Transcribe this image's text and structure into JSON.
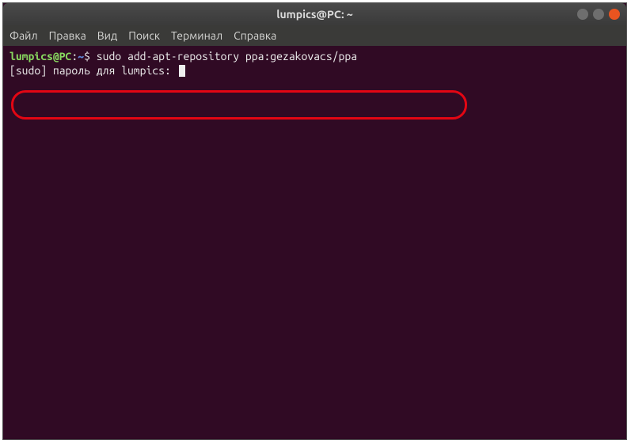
{
  "window": {
    "title": "lumpics@PC: ~"
  },
  "menubar": {
    "items": [
      "Файл",
      "Правка",
      "Вид",
      "Поиск",
      "Терминал",
      "Справка"
    ]
  },
  "terminal": {
    "prompt_user": "lumpics@PC",
    "prompt_colon": ":",
    "prompt_path": "~",
    "prompt_dollar": "$",
    "command": " sudo add-apt-repository ppa:gezakovacs/ppa",
    "output_line": "[sudo] пароль для lumpics: "
  },
  "icons": {
    "minimize": "–",
    "maximize": "□",
    "close": "×"
  }
}
